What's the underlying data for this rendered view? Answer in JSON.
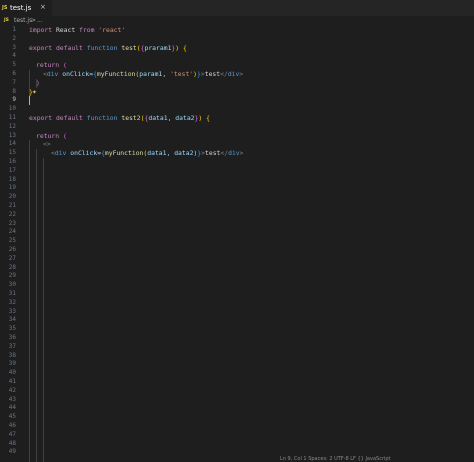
{
  "tab": {
    "icon": "JS",
    "label": "test.js",
    "close": "×"
  },
  "breadcrumb": {
    "icon": "JS",
    "file": "test.js",
    "separator": ">",
    "more": "..."
  },
  "editor": {
    "active_line": 9,
    "line_numbers": [
      "1",
      "2",
      "3",
      "4",
      "5",
      "6",
      "7",
      "8",
      "9",
      "10",
      "11",
      "12",
      "13",
      "14",
      "15",
      "16",
      "17",
      "18",
      "19",
      "20",
      "21",
      "22",
      "23",
      "24",
      "25",
      "26",
      "27",
      "28",
      "29",
      "30",
      "31",
      "32",
      "33",
      "34",
      "35",
      "36",
      "37",
      "38",
      "39",
      "40",
      "41",
      "42",
      "43",
      "44",
      "45",
      "46",
      "47",
      "48",
      "49"
    ],
    "lines": {
      "l1": {
        "kw1": "import",
        "id": " React ",
        "kw2": "from",
        "sp": " ",
        "str": "'react'"
      },
      "l3": {
        "kw1": "export",
        "kw2": " default",
        "kw3": " function",
        "sp": " ",
        "fn": "test",
        "open": "(",
        "b1": "{",
        "param": "praram1",
        "b2": "}",
        "close": ")",
        "sp2": " ",
        "brace": "{"
      },
      "l5": {
        "kw": "return",
        "sp": " ",
        "paren": "("
      },
      "l6": {
        "lt": "<",
        "tag": "div",
        "sp": " ",
        "attr": "onClick",
        "eq": "=",
        "b1": "{",
        "fn": "myFunction",
        "p1": "(",
        "arg": "param1",
        "comma": ", ",
        "str": "'test'",
        "p2": ")",
        "b2": "}",
        "gt": ">",
        "text": "test",
        "close": "</",
        "tag2": "div",
        "gt2": ">"
      },
      "l7": {
        "paren": ")"
      },
      "l8": {
        "brace": "}"
      },
      "l11": {
        "kw1": "export",
        "kw2": " default",
        "kw3": " function",
        "sp": " ",
        "fn": "test2",
        "open": "(",
        "b1": "{",
        "param": "data1, data2",
        "b2": "}",
        "close": ")",
        "sp2": " ",
        "brace": "{"
      },
      "l13": {
        "kw": "return",
        "sp": " ",
        "paren": "("
      },
      "l14": {
        "frag": "<>"
      },
      "l15": {
        "lt": "<",
        "tag": "div",
        "sp": " ",
        "attr": "onClick",
        "eq": "=",
        "b1": "{",
        "fn": "myFunction",
        "p1": "(",
        "arg": "data1, data2",
        "p2": ")",
        "b2": "}",
        "gt": ">",
        "text": "test",
        "close": "</",
        "tag2": "div",
        "gt2": ">"
      }
    }
  },
  "statusbar": {
    "text": "Ln 9, Col 1   Spaces: 2   UTF-8   LF   {} JavaScript"
  }
}
